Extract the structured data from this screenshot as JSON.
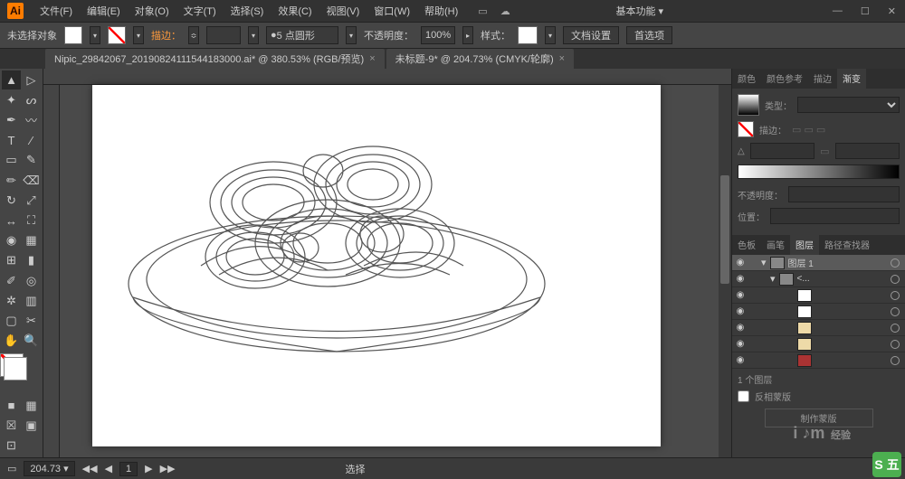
{
  "app": {
    "name": "Ai"
  },
  "menu": [
    "文件(F)",
    "编辑(E)",
    "对象(O)",
    "文字(T)",
    "选择(S)",
    "效果(C)",
    "视图(V)",
    "窗口(W)",
    "帮助(H)"
  ],
  "workspace": "基本功能",
  "controlbar": {
    "selection": "未选择对象",
    "stroke_label": "描边：",
    "stroke_value": "",
    "brush_profile": "5 点圆形",
    "opacity_label": "不透明度：",
    "opacity_value": "100%",
    "style_label": "样式：",
    "doc_setup": "文档设置",
    "prefs": "首选项"
  },
  "tabs": [
    {
      "label": "Nipic_29842067_20190824111544183000.ai* @ 380.53% (RGB/预览)"
    },
    {
      "label": "未标题-9* @ 204.73% (CMYK/轮廓)"
    }
  ],
  "status": {
    "zoom": "204.73",
    "tool": "选择"
  },
  "panels": {
    "gradient": {
      "tabs": [
        "颜色",
        "颜色参考",
        "描边",
        "渐变"
      ],
      "type_label": "类型：",
      "stroke_label": "描边：",
      "angle_label": "△",
      "opacity_label": "不透明度：",
      "position_label": "位置："
    },
    "layers": {
      "tabs": [
        "色板",
        "画笔",
        "图层",
        "路径查找器"
      ],
      "top_layer": "图层 1",
      "sub_layer": "<...",
      "count": "1 个图层",
      "mask_btn": "制作蒙版",
      "checkbox": "反相蒙版"
    }
  },
  "watermark": "经验",
  "ime": "S 五"
}
